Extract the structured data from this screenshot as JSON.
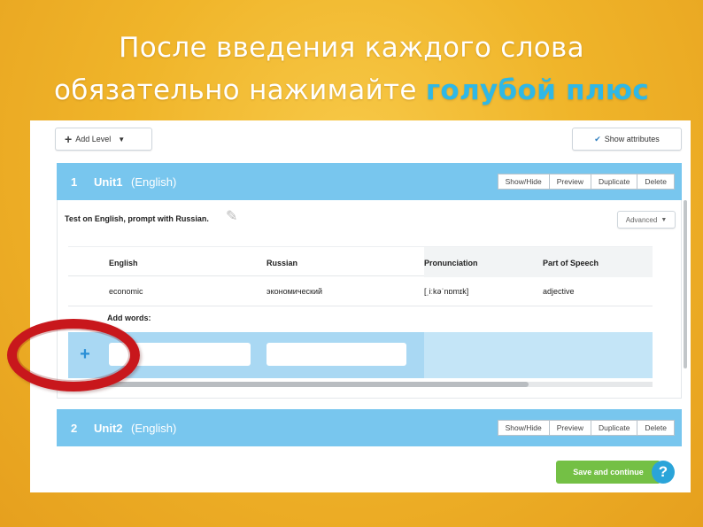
{
  "slide": {
    "title_line1": "После введения каждого слова",
    "title_line2_prefix": "обязательно нажимайте ",
    "title_line2_highlight": "голубой плюс"
  },
  "toolbar": {
    "add_level_label": "Add Level",
    "show_attributes_label": "Show attributes"
  },
  "levels": [
    {
      "number": "1",
      "name": "Unit1",
      "language": "(English)",
      "buttons": [
        "Show/Hide",
        "Preview",
        "Duplicate",
        "Delete"
      ],
      "test_label": "Test on English, prompt with Russian.",
      "advanced_label": "Advanced",
      "columns": [
        "English",
        "Russian",
        "Pronunciation",
        "Part of Speech"
      ],
      "rows": [
        [
          "economic",
          "экономический",
          "[ˌiːkəˈnɒmɪk]",
          "adjective"
        ]
      ],
      "add_words_label": "Add words:",
      "add_button_symbol": "+"
    },
    {
      "number": "2",
      "name": "Unit2",
      "language": "(English)",
      "buttons": [
        "Show/Hide",
        "Preview",
        "Duplicate",
        "Delete"
      ]
    }
  ],
  "footer": {
    "save_label": "Save and continue",
    "help_symbol": "?"
  },
  "colors": {
    "level_header": "#78c6ee",
    "highlight_text": "#2fb8e6",
    "save_button": "#74c045",
    "annotation_circle": "#c8171c"
  },
  "icons": {
    "add_level": "plus-icon",
    "dropdown": "chevron-down-icon",
    "show_attributes": "checkmark-icon",
    "edit": "pencil-icon",
    "help": "question-icon"
  }
}
